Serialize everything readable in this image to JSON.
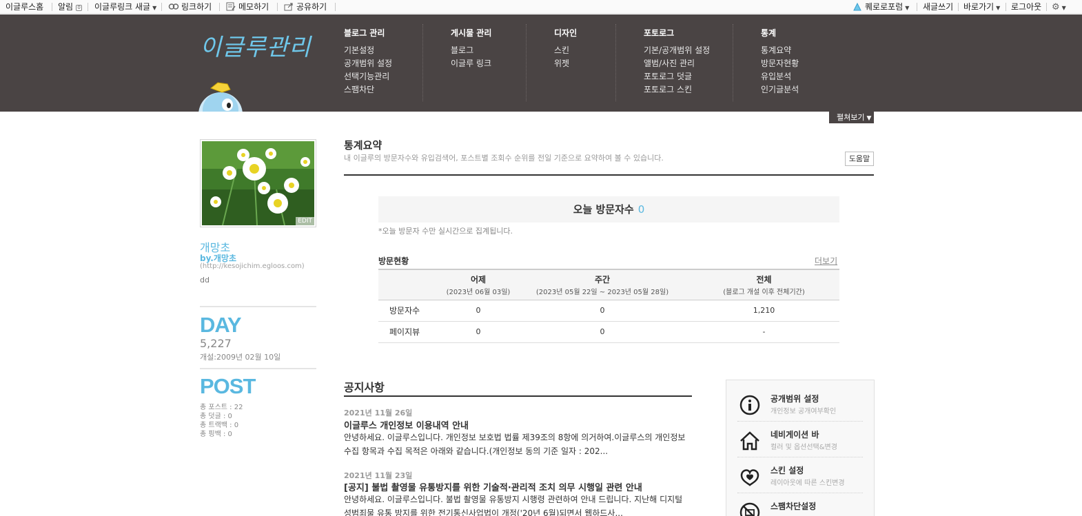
{
  "topbar": {
    "home": "이글루스홈",
    "alarm": "알림",
    "egloolink": "이글루링크 새글",
    "link": "링크하기",
    "memo": "메모하기",
    "share": "공유하기",
    "forum": "퀘로로포럼",
    "write": "새글쓰기",
    "goto": "바로가기",
    "logout": "로그아웃"
  },
  "header": {
    "logo": "이글루관리",
    "menus": [
      {
        "title": "블로그 관리",
        "items": [
          "기본설정",
          "공개범위 설정",
          "선택기능관리",
          "스팸차단"
        ]
      },
      {
        "title": "게시물 관리",
        "items": [
          "블로그",
          "이글루 링크"
        ]
      },
      {
        "title": "디자인",
        "items": [
          "스킨",
          "위젯"
        ]
      },
      {
        "title": "포토로그",
        "items": [
          "기본/공개범위 설정",
          "앨범/사진 관리",
          "포토로그 덧글",
          "포토로그 스킨"
        ]
      },
      {
        "title": "통계",
        "items": [
          "통계요약",
          "방문자현황",
          "유입분석",
          "인기글분석"
        ]
      }
    ],
    "expand": "펼쳐보기"
  },
  "profile": {
    "edit": "EDIT",
    "name": "개망초",
    "by": "by.개망초",
    "url": "(http://kesojichim.egloos.com)",
    "desc": "dd",
    "day_label": "DAY",
    "day_count": "5,227",
    "opened": "개설:2009년 02월 10일",
    "post_label": "POST",
    "stats": [
      "총 포스트 : 22",
      "총 덧글 : 0",
      "총 트랙백 : 0",
      "총 핑백 : 0"
    ]
  },
  "summary": {
    "title": "통계요약",
    "desc": "내 이글루의 방문자수와 유입검색어, 포스트별 조회수 순위를 전일 기준으로 요약하여 볼 수 있습니다.",
    "help": "도움말",
    "today_label": "오늘 방문자수",
    "today_count": "0",
    "today_note": "*오늘 방문자 수만 실시간으로 집계됩니다.",
    "visit_title": "방문현황",
    "more": "더보기",
    "columns": [
      {
        "label": "어제",
        "sub": "(2023년 06월 03일)"
      },
      {
        "label": "주간",
        "sub": "(2023년 05월 22일 ~ 2023년 05월 28일)"
      },
      {
        "label": "전체",
        "sub": "(블로그 개설 이후 전체기간)"
      }
    ],
    "rows": [
      {
        "label": "방문자수",
        "values": [
          "0",
          "0",
          "1,210"
        ]
      },
      {
        "label": "페이지뷰",
        "values": [
          "0",
          "0",
          "-"
        ]
      }
    ]
  },
  "notices": {
    "title": "공지사항",
    "items": [
      {
        "date": "2021년 11월 26일",
        "title": "이글루스 개인정보 이용내역 안내",
        "body": "안녕하세요. 이글루스입니다. 개인정보 보호법 법률 제39조의 8항에 의거하여.이글루스의 개인정보 수집 항목과 수집 목적은 아래와 같습니다.(개인정보 동의 기준 일자 : 202..."
      },
      {
        "date": "2021년 11월 23일",
        "title": "[공지] 불법 촬영물 유통방지를 위한 기술적·관리적 조치 의무 시행일 관련 안내",
        "body": "안녕하세요. 이글루스입니다. 불법 촬영물 유통방지 시행령 관련하여 안내 드립니다. 지난해 디지털성범죄물 유통 방지를 위한 전기통신사업법이 개정('20년 6월)되면서 웹하드사..."
      }
    ]
  },
  "panel": {
    "items": [
      {
        "title": "공개범위 설정",
        "sub": "개인정보 공개여부확인",
        "icon": "info-icon"
      },
      {
        "title": "네비게이션 바",
        "sub": "컬러 및 옵션선택&변경",
        "icon": "home-icon"
      },
      {
        "title": "스킨 설정",
        "sub": "레이아웃에 따른 스킨변경",
        "icon": "heart-bubble-icon"
      },
      {
        "title": "스팸차단설정",
        "sub": "",
        "icon": "spam-block-icon"
      }
    ]
  },
  "colors": {
    "header_bg": "#4a4444",
    "accent_blue": "#5ab8e0"
  }
}
